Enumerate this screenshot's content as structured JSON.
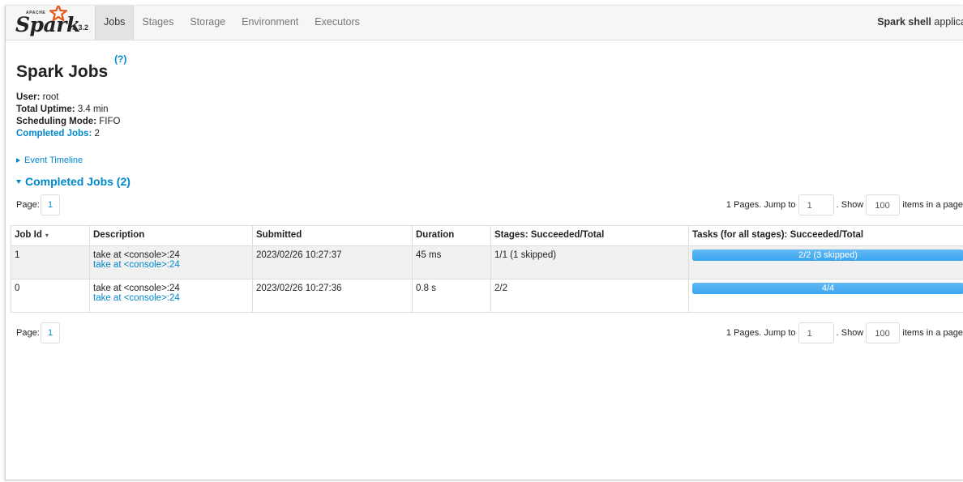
{
  "brand": {
    "apache": "APACHE",
    "logo": "Spark",
    "version": "3.3.2"
  },
  "nav": {
    "tabs": [
      {
        "label": "Jobs",
        "active": true
      },
      {
        "label": "Stages"
      },
      {
        "label": "Storage"
      },
      {
        "label": "Environment"
      },
      {
        "label": "Executors"
      }
    ],
    "app_name": "Spark shell",
    "app_suffix": "applica"
  },
  "page": {
    "title": "Spark Jobs",
    "help": "(?)",
    "summary": {
      "user_label": "User:",
      "user": "root",
      "uptime_label": "Total Uptime:",
      "uptime": "3.4 min",
      "mode_label": "Scheduling Mode:",
      "mode": "FIFO",
      "completed_label": "Completed Jobs:",
      "completed": "2"
    },
    "event_timeline": "Event Timeline",
    "section_title": "Completed Jobs (2)"
  },
  "pager": {
    "page_label": "Page:",
    "page": "1",
    "pages_text": "1 Pages. Jump to",
    "jump_value": "1",
    "show_text": ". Show",
    "show_value": "100",
    "items_text": "items in a page"
  },
  "table": {
    "headers": {
      "job_id": "Job Id",
      "sort_indicator": "▾",
      "description": "Description",
      "submitted": "Submitted",
      "duration": "Duration",
      "stages": "Stages: Succeeded/Total",
      "tasks": "Tasks (for all stages): Succeeded/Total"
    },
    "rows": [
      {
        "job_id": "1",
        "desc": "take at <console>:24",
        "desc_link": "take at <console>:24",
        "submitted": "2023/02/26 10:27:37",
        "duration": "45 ms",
        "stages": "1/1 (1 skipped)",
        "tasks": "2/2 (3 skipped)",
        "tasks_progress": 1.0
      },
      {
        "job_id": "0",
        "desc": "take at <console>:24",
        "desc_link": "take at <console>:24",
        "submitted": "2023/02/26 10:27:36",
        "duration": "0.8 s",
        "stages": "2/2",
        "tasks": "4/4",
        "tasks_progress": 1.0
      }
    ]
  },
  "colors": {
    "link": "#0088cc",
    "progress": "#3aa6f0",
    "navbar": "#f6f6f6"
  }
}
